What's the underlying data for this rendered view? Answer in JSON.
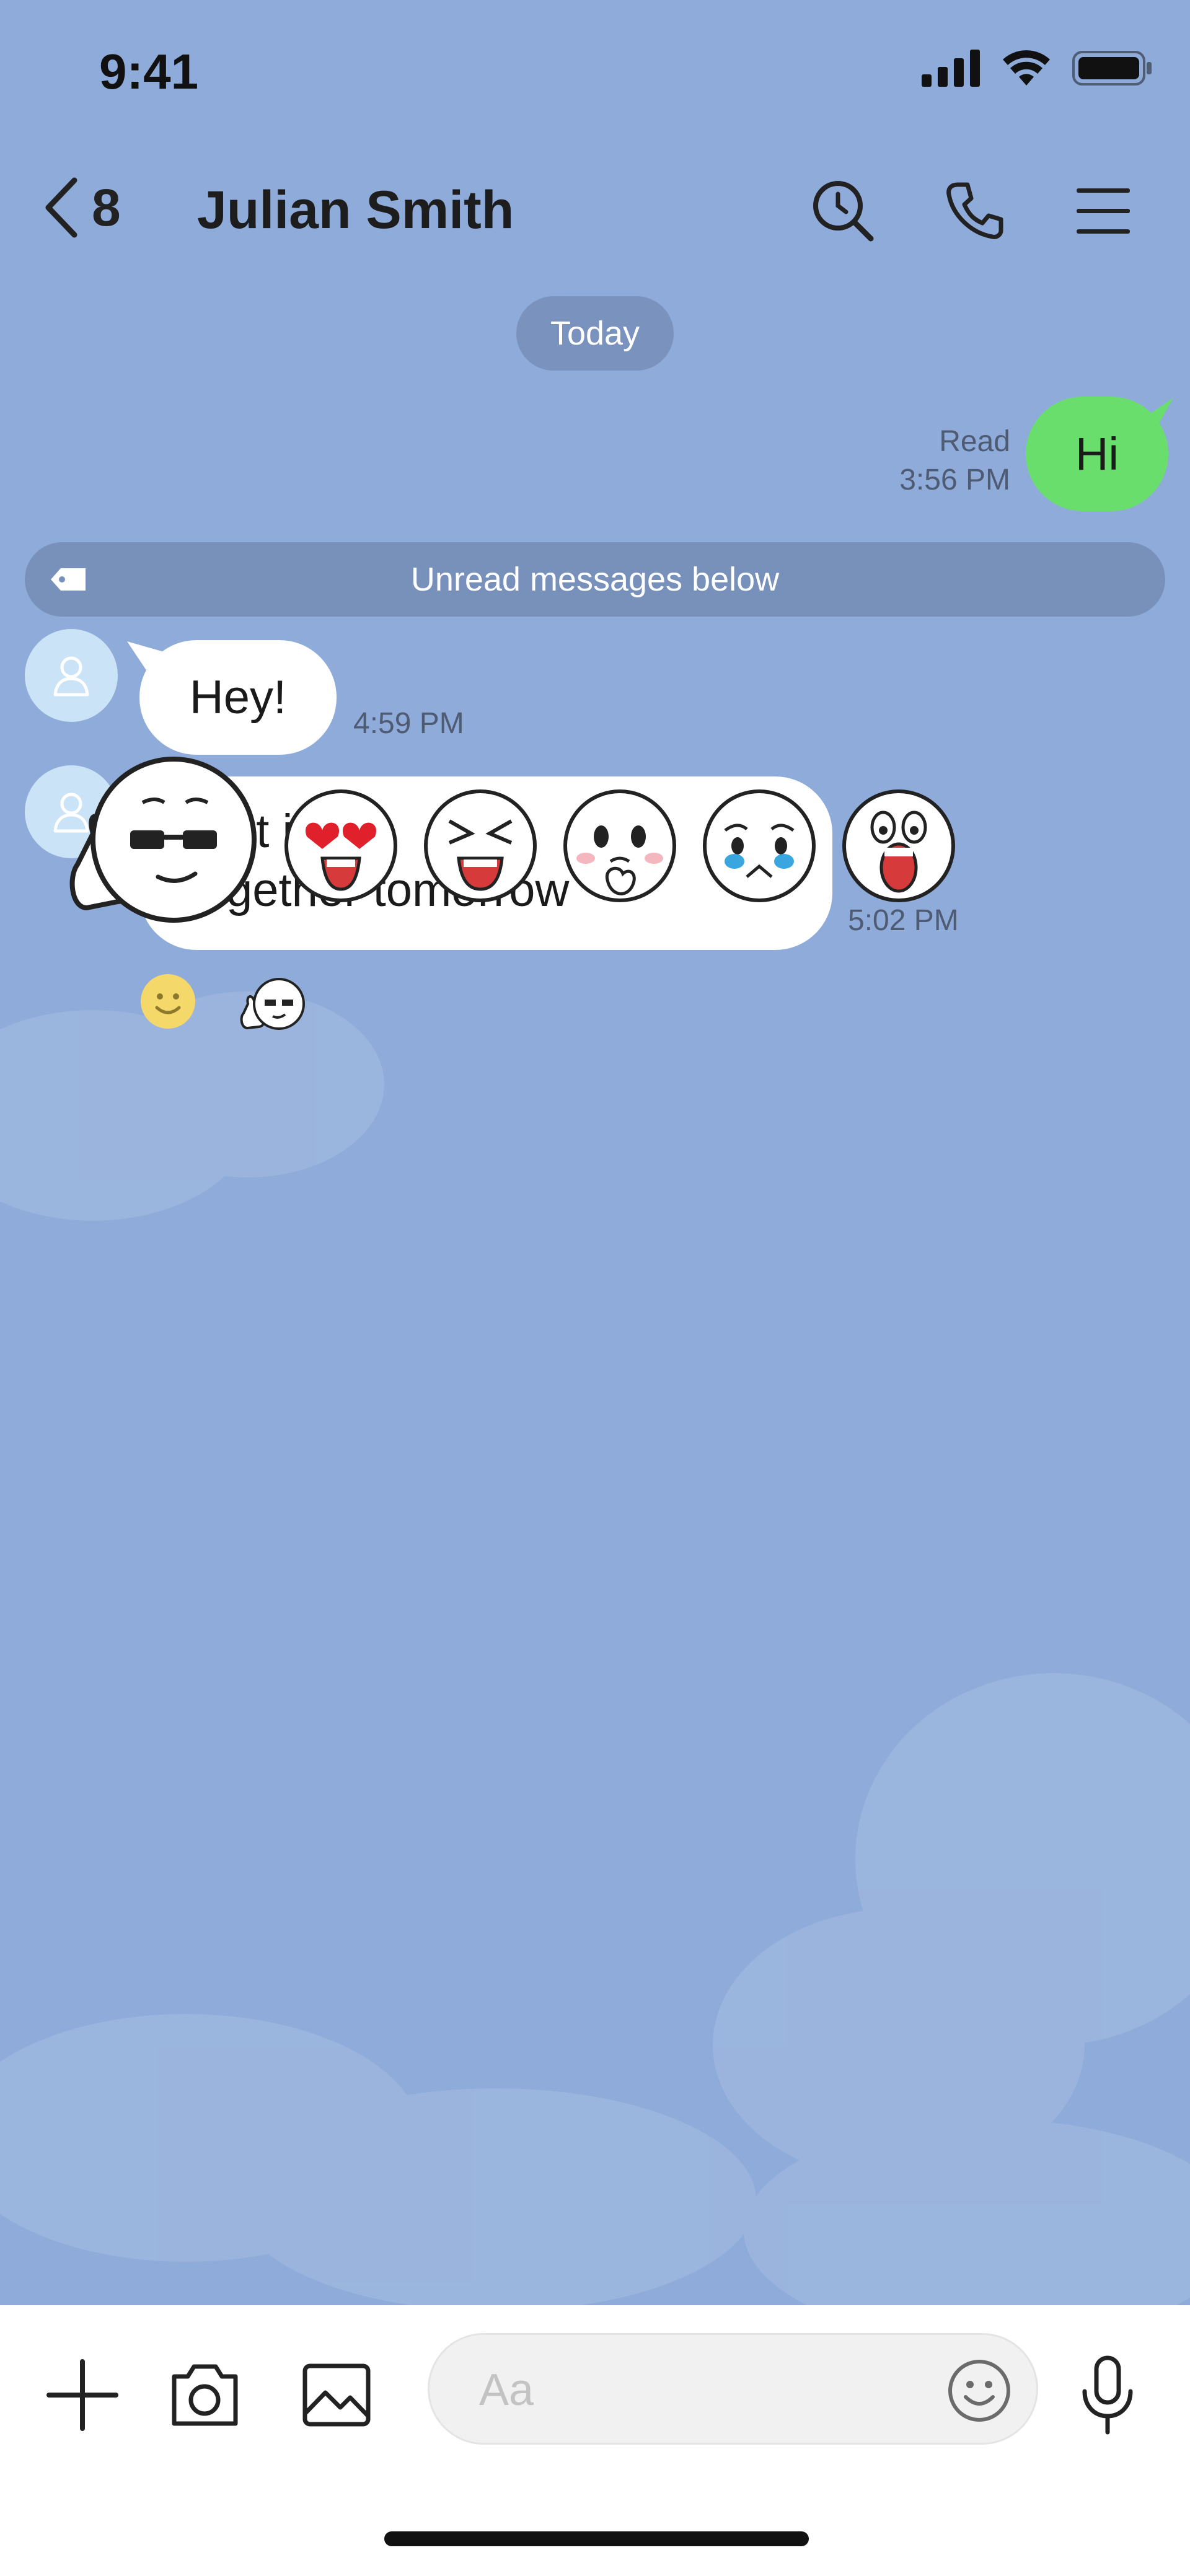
{
  "status_bar": {
    "time": "9:41",
    "icons": [
      "signal-icon",
      "wifi-icon",
      "battery-icon"
    ]
  },
  "header": {
    "back_count": "8",
    "title": "Julian Smith",
    "icons": [
      "search-icon",
      "phone-icon",
      "menu-icon"
    ]
  },
  "chat": {
    "date_divider": "Today",
    "outgoing": {
      "text": "Hi",
      "status": "Read",
      "time": "3:56 PM"
    },
    "unread_banner": "Unread messages below",
    "incoming": [
      {
        "text": "Hey!",
        "time": "4:59 PM"
      },
      {
        "line1": "How about going out",
        "line2": "together tomorrow",
        "line1_visible": "w      ut       in        ur",
        "line2_visible": "gether tomorrow",
        "time": "5:02 PM"
      }
    ],
    "reactions": [
      "smile-reaction-icon",
      "thumbs-up-sticker-icon"
    ]
  },
  "composer": {
    "placeholder": "Aa",
    "tools": [
      "plus-icon",
      "camera-icon",
      "image-icon"
    ],
    "emoji_icon": "emoji-icon",
    "mic_icon": "mic-icon"
  },
  "colors": {
    "background": "#8eabd9",
    "outgoing_bubble": "#6ade6d",
    "incoming_bubble": "#ffffff",
    "pill": "#7a92be"
  }
}
